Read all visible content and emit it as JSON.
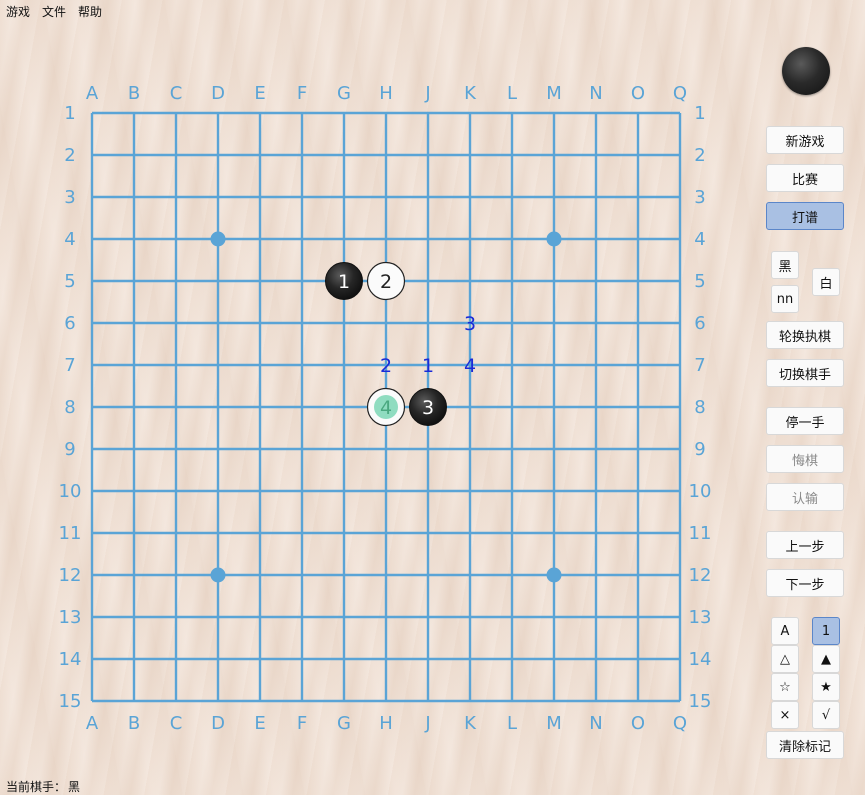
{
  "menu": {
    "game": "游戏",
    "file": "文件",
    "help": "帮助"
  },
  "board": {
    "size": 15,
    "columns": [
      "A",
      "B",
      "C",
      "D",
      "E",
      "F",
      "G",
      "H",
      "J",
      "K",
      "L",
      "M",
      "N",
      "O",
      "Q"
    ],
    "rows": [
      "1",
      "2",
      "3",
      "4",
      "5",
      "6",
      "7",
      "8",
      "9",
      "10",
      "11",
      "12",
      "13",
      "14",
      "15"
    ],
    "line_color": "#5aa4d6",
    "star_points": [
      [
        "D",
        "4"
      ],
      [
        "M",
        "4"
      ],
      [
        "D",
        "12"
      ],
      [
        "M",
        "12"
      ]
    ],
    "stones": [
      {
        "color": "black",
        "col": "G",
        "row": "5",
        "label": "1"
      },
      {
        "color": "white",
        "col": "H",
        "row": "5",
        "label": "2"
      },
      {
        "color": "black",
        "col": "J",
        "row": "8",
        "label": "3"
      },
      {
        "color": "white",
        "col": "H",
        "row": "8",
        "label": "4",
        "last": true
      }
    ],
    "marks": [
      {
        "col": "J",
        "row": "7",
        "label": "1"
      },
      {
        "col": "H",
        "row": "7",
        "label": "2"
      },
      {
        "col": "K",
        "row": "6",
        "label": "3"
      },
      {
        "col": "K",
        "row": "7",
        "label": "4"
      }
    ]
  },
  "side": {
    "current_turn": "black",
    "new_game": "新游戏",
    "match": "比赛",
    "record": "打谱",
    "black": "黑",
    "white": "白",
    "nn": "nn",
    "swap_color": "轮换执棋",
    "switch_player": "切换棋手",
    "pass": "停一手",
    "undo": "悔棋",
    "resign": "认输",
    "prev": "上一步",
    "next": "下一步",
    "mark_letter": "A",
    "mark_number": "1",
    "mark_triangle_outline": "△",
    "mark_triangle_filled": "▲",
    "mark_star_outline": "☆",
    "mark_star_filled": "★",
    "mark_cross": "×",
    "mark_check": "√",
    "clear_marks": "清除标记"
  },
  "status": {
    "label": "当前棋手：",
    "player": "黑"
  }
}
